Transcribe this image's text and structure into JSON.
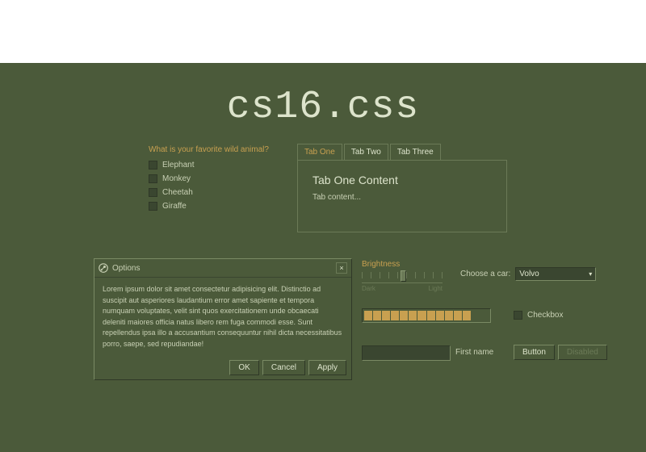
{
  "title": "cs16.css",
  "radio": {
    "question": "What is your favorite wild animal?",
    "options": [
      "Elephant",
      "Monkey",
      "Cheetah",
      "Giraffe"
    ]
  },
  "tabs": {
    "items": [
      "Tab One",
      "Tab Two",
      "Tab Three"
    ],
    "active": 0,
    "panel": {
      "heading": "Tab One Content",
      "body": "Tab content..."
    }
  },
  "dialog": {
    "title": "Options",
    "close": "×",
    "body": "Lorem ipsum dolor sit amet consectetur adipisicing elit. Distinctio ad suscipit aut asperiores laudantium error amet sapiente et tempora numquam voluptates, velit sint quos exercitationem unde obcaecati deleniti maiores officia natus libero rem fuga commodi esse. Sunt repellendus ipsa illo a accusantium consequuntur nihil dicta necessitatibus porro, saepe, sed repudiandae!",
    "buttons": {
      "ok": "OK",
      "cancel": "Cancel",
      "apply": "Apply"
    }
  },
  "slider": {
    "label": "Brightness",
    "min_label": "Dark",
    "max_label": "Light",
    "value_pct": 50
  },
  "select": {
    "label": "Choose a car:",
    "value": "Volvo"
  },
  "progress": {
    "segments": 14,
    "filled": 12
  },
  "checkbox": {
    "label": "Checkbox",
    "checked": false
  },
  "input": {
    "value": "",
    "label": "First name"
  },
  "buttons": {
    "normal": "Button",
    "disabled": "Disabled"
  },
  "colors": {
    "bg": "#4b5a3a",
    "accent": "#c8a050",
    "text": "#dde4cc"
  }
}
